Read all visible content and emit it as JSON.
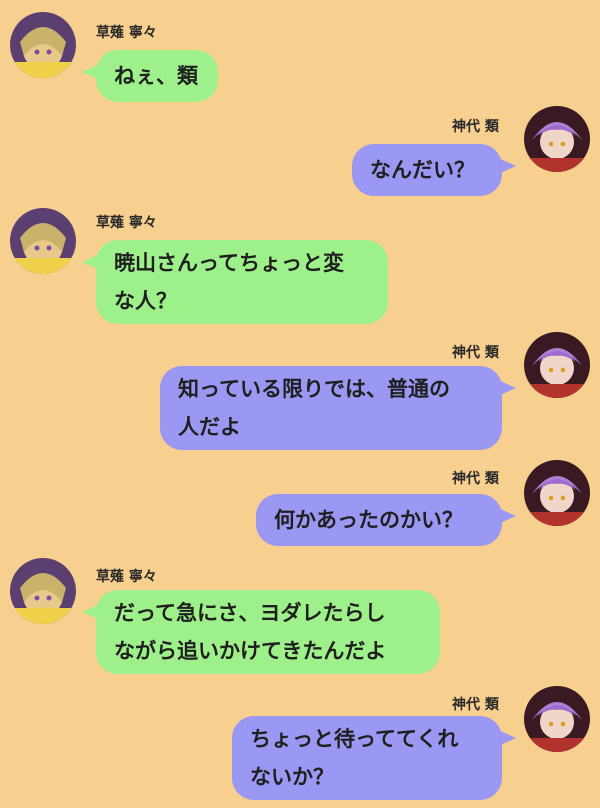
{
  "chat": {
    "messages": [
      {
        "side": "left",
        "sender": "草薙 寧々",
        "text": "ねぇ、類"
      },
      {
        "side": "right",
        "sender": "神代 類",
        "text": "なんだい？"
      },
      {
        "side": "left",
        "sender": "草薙 寧々",
        "text": "暁山さんってちょっと変\nな人？"
      },
      {
        "side": "right",
        "sender": "神代 類",
        "text": "知っている限りでは、普通の\n人だよ"
      },
      {
        "side": "right",
        "sender": "神代 類",
        "text": "何かあったのかい？"
      },
      {
        "side": "left",
        "sender": "草薙 寧々",
        "text": "だって急にさ、ヨダレたらし\nながら追いかけてきたんだよ"
      },
      {
        "side": "right",
        "sender": "神代 類",
        "text": "ちょっと待っててくれ\nないか？"
      }
    ]
  },
  "colors": {
    "background": "#f7cf8f",
    "left_bubble": "#9ef08a",
    "right_bubble": "#9a98f2"
  },
  "icons": {
    "left_avatar": "nene-avatar-icon",
    "right_avatar": "rui-avatar-icon"
  }
}
